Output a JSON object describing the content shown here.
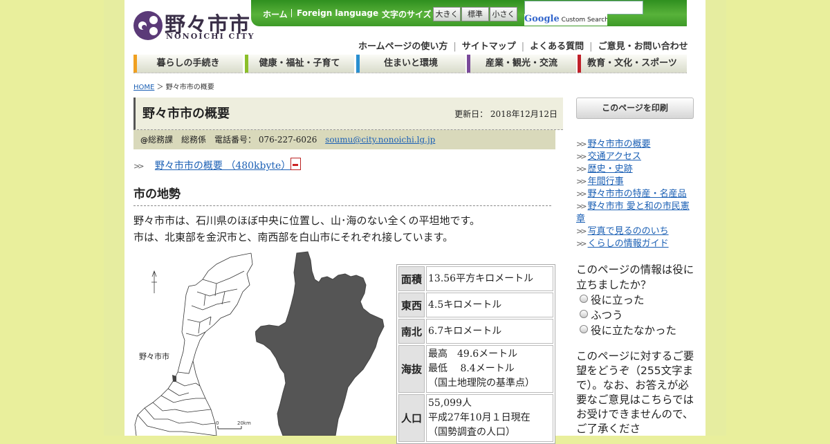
{
  "site": {
    "logo_jp": "野々市市",
    "logo_en": "NONOICHI CITY"
  },
  "topbar": {
    "home": "ホーム",
    "foreign": "Foreign language",
    "font_size_label": "文字のサイズ",
    "font_large": "大きく",
    "font_normal": "標準",
    "font_small": "小さく",
    "search_brand": "Google",
    "search_brand_suffix": "Custom Search"
  },
  "sublinks": [
    "ホームページの使い方",
    "サイトマップ",
    "よくある質問",
    "ご意見・お問い合わせ"
  ],
  "gnav": [
    {
      "label": "暮らしの手続き",
      "color": "#f0a020"
    },
    {
      "label": "健康・福祉・子育て",
      "color": "#8cbf2a"
    },
    {
      "label": "住まいと環境",
      "color": "#2a8fd0"
    },
    {
      "label": "産業・観光・交流",
      "color": "#7a4a9a"
    },
    {
      "label": "教育・文化・スポーツ",
      "color": "#c0202a"
    }
  ],
  "breadcrumb": {
    "home": "HOME",
    "sep": "＞",
    "current": "野々市市の概要"
  },
  "page": {
    "title": "野々市市の概要",
    "updated_label": "更新日：",
    "updated": "2018年12月12日",
    "contact_dept": "総務課　総務係",
    "contact_phone_label": "電話番号：",
    "contact_phone": "076-227-6026",
    "contact_email": "soumu@city.nonoichi.lg.jp",
    "pdf_link": "野々市市の概要 （480kbyte）",
    "section_title": "市の地勢",
    "body_line1": "野々市市は、石川県のほぼ中央に位置し、山･海のない全くの平坦地です。",
    "body_line2": "市は、北東部を金沢市と、南西部を白山市にそれぞれ接しています。",
    "map_label": "野々市市",
    "scale_zero": "0",
    "scale_km": "20km"
  },
  "facts": [
    {
      "key": "面積",
      "lines": [
        "13.56平方キロメートル"
      ]
    },
    {
      "key": "東西",
      "lines": [
        "4.5キロメートル"
      ]
    },
    {
      "key": "南北",
      "lines": [
        "6.7キロメートル"
      ]
    },
    {
      "key": "海抜",
      "lines": [
        "最高　49.6メートル",
        "最低　 8.4メートル",
        "（国土地理院の基準点）"
      ]
    },
    {
      "key": "人口",
      "lines": [
        "55,099人",
        "平成27年10月１日現在",
        "（国勢調査の人口）"
      ]
    }
  ],
  "sidebar": {
    "print_button": "このページを印刷",
    "links": [
      "野々市市の概要",
      "交通アクセス",
      "歴史・史跡",
      "年間行事",
      "野々市市の特産・名産品",
      "野々市市 愛と和の市民憲章",
      "写真で見るののいち",
      "くらしの情報ガイド"
    ],
    "survey_question": "このページの情報は役に立ちましたか？",
    "survey_options": [
      "役に立った",
      "ふつう",
      "役に立たなかった"
    ],
    "request_text": "このページに対するご要望をどうぞ（255文字まで）。なお、お答えが必要なご意見はこちらではお受けできませんので、ご了承くださ"
  }
}
